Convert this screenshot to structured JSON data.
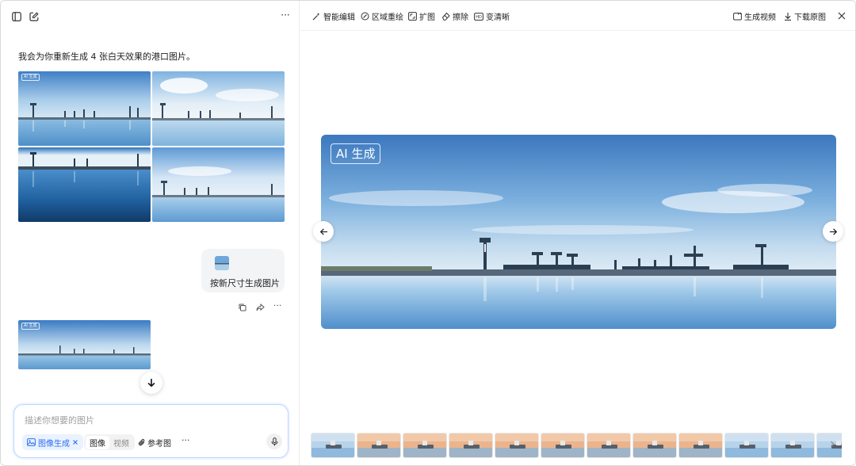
{
  "left_panel": {
    "assistant_message": "我会为你重新生成 4 张白天效果的港口图片。",
    "image_tag": "AI 生成",
    "user_message": "按新尺寸生成图片",
    "input": {
      "placeholder": "描述你想要的图片",
      "mode_chip": "图像生成",
      "segment": [
        "图像",
        "视频"
      ],
      "reference_label": "参考图",
      "more": "···"
    },
    "header_more": "···"
  },
  "toolbar": {
    "smart_edit": "智能编辑",
    "region_redraw": "区域重绘",
    "expand": "扩图",
    "erase": "擦除",
    "sharpen": "变清晰",
    "generate_video": "生成视频",
    "download": "下载原图"
  },
  "viewer": {
    "ai_tag": "AI 生成"
  },
  "icons": [
    "sidebar-icon",
    "new-chat-icon",
    "copy-icon",
    "share-icon",
    "more-icon",
    "arrow-down-icon",
    "image-icon",
    "close-icon",
    "paperclip-icon",
    "mic-icon",
    "sparkle-icon",
    "brush-icon",
    "expand-icon",
    "eraser-icon",
    "hd-icon",
    "video-icon",
    "download-icon",
    "arrow-left-icon",
    "arrow-right-icon",
    "chevron-right-icon"
  ],
  "colors": {
    "accent": "#2a6ff0",
    "sky_top": "#4e88c9",
    "sky_mid": "#9ec6e8",
    "water": "#6aa6d6",
    "sunset": "#f3b98a"
  },
  "filmstrip_count": 12
}
